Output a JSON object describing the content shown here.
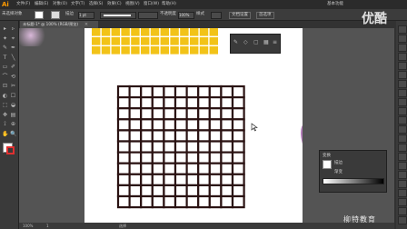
{
  "app": {
    "logo": "Ai",
    "menus": [
      "文件(F)",
      "编辑(E)",
      "对象(O)",
      "文字(T)",
      "选择(S)",
      "效果(C)",
      "视图(V)",
      "窗口(W)",
      "帮助(H)"
    ],
    "workspace": "基本功能",
    "watermark_top": "优酷",
    "watermark_bottom": "柳特教育"
  },
  "options_bar": {
    "selection_label": "未选择对象",
    "stroke_label": "描边",
    "stroke_value": "1 pt",
    "style_label": "不透明度",
    "opacity_value": "100%",
    "style2_label": "样式",
    "doc_setup_label": "文档设置",
    "prefs_label": "首选项"
  },
  "document": {
    "tab_title": "未标题-1* @ 100% (RGB/预览)"
  },
  "status": {
    "zoom": "100%",
    "page": "1",
    "tool": "选择"
  },
  "panels": {
    "properties_title": "变换",
    "properties_row1": "描边",
    "properties_row2": "渐变"
  },
  "colors": {
    "accent": "#ff9a00",
    "yellow_grid": "#f2c318",
    "grid_stroke": "#2a1212",
    "canvas_bg": "#545454"
  }
}
